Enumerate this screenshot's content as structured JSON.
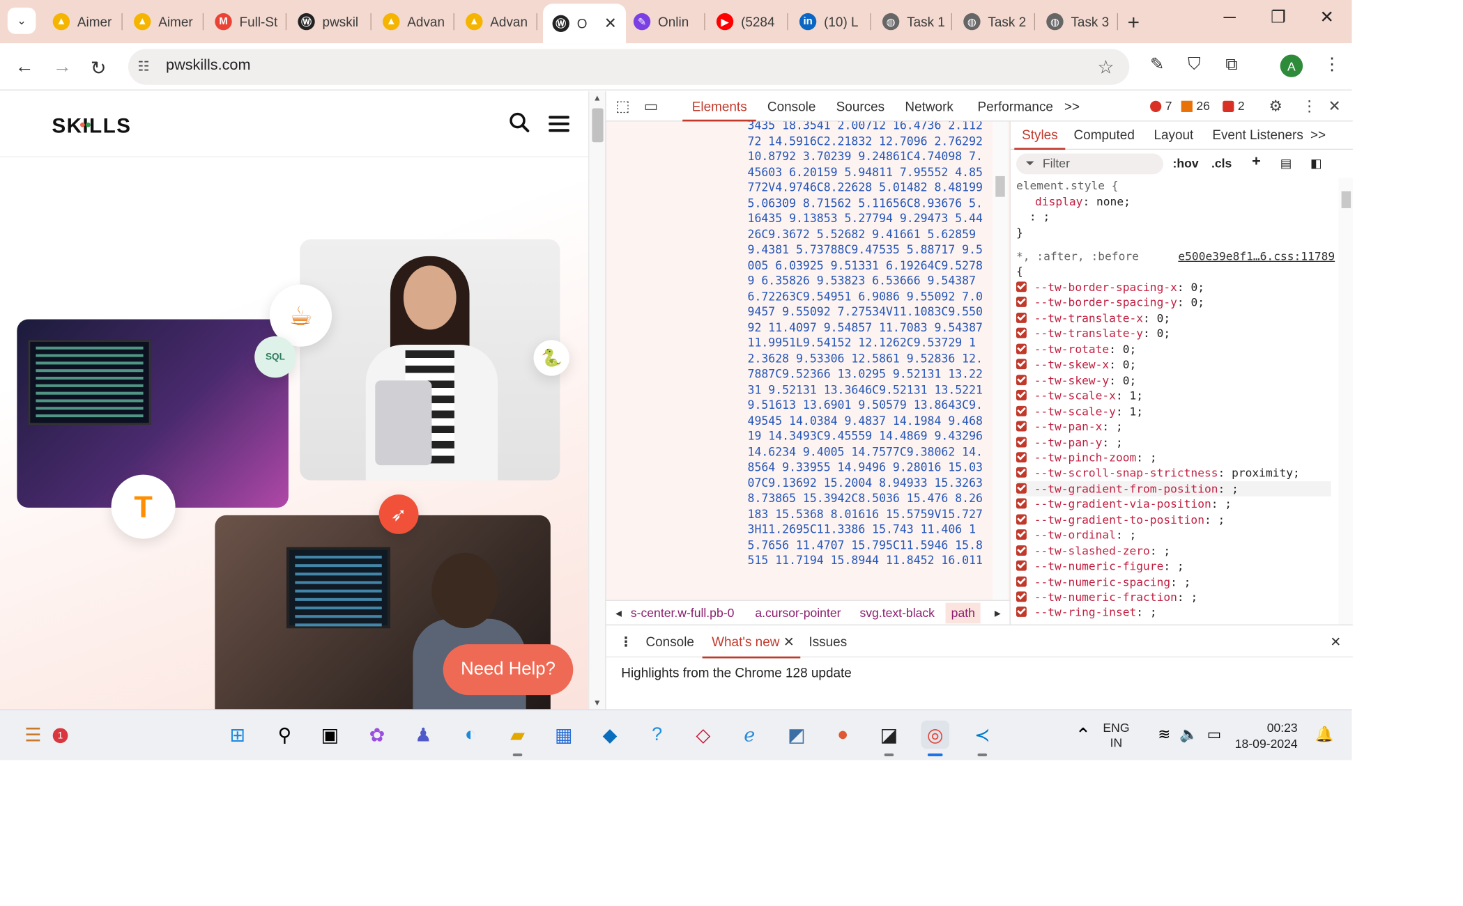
{
  "browser": {
    "tabs": [
      {
        "title": "Aimer",
        "favicon": "drive-icon"
      },
      {
        "title": "Aimer",
        "favicon": "drive-icon"
      },
      {
        "title": "Full-St",
        "favicon": "gmail-icon"
      },
      {
        "title": "pwskil",
        "favicon": "pw-icon"
      },
      {
        "title": "Advan",
        "favicon": "drive-icon"
      },
      {
        "title": "Advan",
        "favicon": "drive-icon"
      },
      {
        "title": "O",
        "favicon": "pw-icon",
        "active": true
      },
      {
        "title": "Onlin",
        "favicon": "feather-icon"
      },
      {
        "title": "(5284",
        "favicon": "youtube-icon"
      },
      {
        "title": "(10) L",
        "favicon": "linkedin-icon"
      },
      {
        "title": "Task 1",
        "favicon": "globe-icon"
      },
      {
        "title": "Task 2",
        "favicon": "globe-icon"
      },
      {
        "title": "Task 3",
        "favicon": "globe-icon"
      }
    ],
    "url": "pwskills.com",
    "profile_initial": "A",
    "accent": "#f3d9cf"
  },
  "site": {
    "logo_text": "SKILLS",
    "need_help": "Need Help?",
    "brand_color": "#ef6a55"
  },
  "devtools": {
    "tabs": [
      "Elements",
      "Console",
      "Sources",
      "Network",
      "Performance"
    ],
    "more": ">>",
    "errors": "7",
    "warnings": "26",
    "issues": "2",
    "elements_code": [
      "3435 18.3541 2.00712 16.4736 2.112",
      "72 14.5916C2.21832 12.7096 2.76292",
      "10.8792 3.70239 9.24861C4.74098 7.",
      "45603 6.20159 5.94811 7.95552 4.85",
      "772V4.9746C8.22628 5.01482 8.48199",
      "5.06309 8.71562 5.11656C8.93676 5.",
      "16435 9.13853 5.27794 9.29473 5.44",
      "26C9.3672 5.52682 9.41661 5.62859",
      "9.4381 5.73788C9.47535 5.88717 9.5",
      "005 6.03925 9.51331 6.19264C9.5278",
      "9 6.35826 9.53823 6.53666 9.54387",
      "6.72263C9.54951 6.9086 9.55092 7.0",
      "9457 9.55092 7.27534V11.1083C9.550",
      "92 11.4097 9.54857 11.7083 9.54387",
      "11.9951L9.54152 12.1262C9.53729 1",
      "2.3628 9.53306 12.5861 9.52836 12.",
      "7887C9.52366 13.0295 9.52131 13.22",
      "31 9.52131 13.3646C9.52131 13.5221",
      "9.51613 13.6901 9.50579 13.8643C9.",
      "49545 14.0384 9.4837 14.1984 9.468",
      "19 14.3493C9.45559 14.4869 9.43296",
      "14.6234 9.4005 14.7577C9.38062 14.",
      "8564 9.33955 14.9496 9.28016 15.03",
      "07C9.13692 15.2004 8.94933 15.3263",
      "8.73865 15.3942C8.5036 15.476 8.26",
      "183 15.5368 8.01616 15.5759V15.727",
      "3H11.2695C11.3386 15.743 11.406 1",
      "5.7656 11.4707 15.795C11.5946 15.8",
      "515 11.7194 15.8944 11.8452 16.011"
    ],
    "breadcrumbs": [
      "s-center.w-full.pb-0",
      "a.cursor-pointer",
      "svg.text-black",
      "path"
    ],
    "styles_tabs": [
      "Styles",
      "Computed",
      "Layout",
      "Event Listeners",
      ">>"
    ],
    "filter_placeholder": "Filter",
    "hov": ":hov",
    "cls": ".cls",
    "element_style": {
      "selector": "element.style {",
      "decl_prop": "display",
      "decl_val": "none;",
      "empty_decl": ": ;",
      "close": "}"
    },
    "universal_rule": {
      "selector": "*, :after, :before",
      "source": "e500e39e8f1…6.css:11789",
      "open": "{",
      "declarations": [
        {
          "prop": "--tw-border-spacing-x",
          "val": "0;"
        },
        {
          "prop": "--tw-border-spacing-y",
          "val": "0;"
        },
        {
          "prop": "--tw-translate-x",
          "val": "0;"
        },
        {
          "prop": "--tw-translate-y",
          "val": "0;"
        },
        {
          "prop": "--tw-rotate",
          "val": "0;"
        },
        {
          "prop": "--tw-skew-x",
          "val": "0;"
        },
        {
          "prop": "--tw-skew-y",
          "val": "0;"
        },
        {
          "prop": "--tw-scale-x",
          "val": "1;"
        },
        {
          "prop": "--tw-scale-y",
          "val": "1;"
        },
        {
          "prop": "--tw-pan-x",
          "val": ";"
        },
        {
          "prop": "--tw-pan-y",
          "val": ";"
        },
        {
          "prop": "--tw-pinch-zoom",
          "val": ";"
        },
        {
          "prop": "--tw-scroll-snap-strictness",
          "val": "proximity;"
        },
        {
          "prop": "--tw-gradient-from-position",
          "val": ";",
          "highlight": true
        },
        {
          "prop": "--tw-gradient-via-position",
          "val": ";"
        },
        {
          "prop": "--tw-gradient-to-position",
          "val": ";"
        },
        {
          "prop": "--tw-ordinal",
          "val": ";"
        },
        {
          "prop": "--tw-slashed-zero",
          "val": ";"
        },
        {
          "prop": "--tw-numeric-figure",
          "val": ";"
        },
        {
          "prop": "--tw-numeric-spacing",
          "val": ";"
        },
        {
          "prop": "--tw-numeric-fraction",
          "val": ";"
        },
        {
          "prop": "--tw-ring-inset",
          "val": ";"
        }
      ]
    },
    "drawer": {
      "tabs": [
        "Console",
        "What's new",
        "Issues"
      ],
      "active": "What's new",
      "message": "Highlights from the Chrome 128 update"
    }
  },
  "taskbar": {
    "notification_count": "1",
    "lang_line1": "ENG",
    "lang_line2": "IN",
    "time": "00:23",
    "date": "18-09-2024"
  }
}
